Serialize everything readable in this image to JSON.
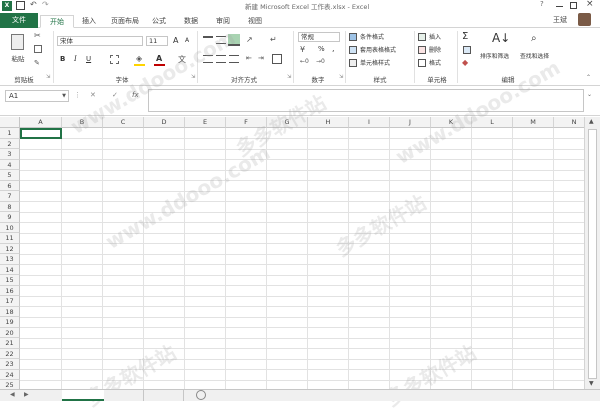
{
  "window": {
    "title": "新建 Microsoft Excel 工作表.xlsx - Excel",
    "user": "王斌"
  },
  "tabs": {
    "file": "文件",
    "items": [
      "开始",
      "插入",
      "页面布局",
      "公式",
      "数据",
      "审阅",
      "视图"
    ],
    "active": "开始"
  },
  "ribbon": {
    "clipboard": {
      "paste": "粘贴",
      "group": "剪贴板"
    },
    "font": {
      "name": "宋体",
      "size": "11",
      "bold": "B",
      "italic": "I",
      "underline": "U",
      "grow": "A",
      "shrink": "A",
      "group": "字体"
    },
    "alignment": {
      "group": "对齐方式"
    },
    "number": {
      "format": "常规",
      "percent": "%",
      "comma": ",",
      "group": "数字"
    },
    "styles": {
      "conditional": "条件格式",
      "table": "套用表格格式",
      "cell": "单元格样式",
      "group": "样式"
    },
    "cells": {
      "insert": "插入",
      "delete": "删除",
      "format": "格式",
      "group": "单元格"
    },
    "editing": {
      "sum": "Σ",
      "sort": "排序和筛选",
      "find": "查找和选择",
      "group": "编辑"
    }
  },
  "formula_bar": {
    "name_box": "A1",
    "cancel": "✕",
    "enter": "✓",
    "fx": "fx",
    "value": ""
  },
  "grid": {
    "columns": [
      "A",
      "B",
      "C",
      "D",
      "E",
      "F",
      "G",
      "H",
      "I",
      "J",
      "K",
      "L",
      "M",
      "N"
    ],
    "rows": [
      "1",
      "2",
      "3",
      "4",
      "5",
      "6",
      "7",
      "8",
      "9",
      "10",
      "11",
      "12",
      "13",
      "14",
      "15",
      "16",
      "17",
      "18",
      "19",
      "20",
      "21",
      "22",
      "23",
      "24",
      "25"
    ]
  },
  "watermarks": [
    "www.ddooo.com",
    "www.ddooo.com",
    "www.ddooo.com",
    "多多软件站",
    "多多软件站",
    "多多软件站",
    "多多软件站"
  ],
  "colors": {
    "accent": "#217346",
    "fill_yellow": "#ffd400",
    "font_red": "#c00000"
  }
}
